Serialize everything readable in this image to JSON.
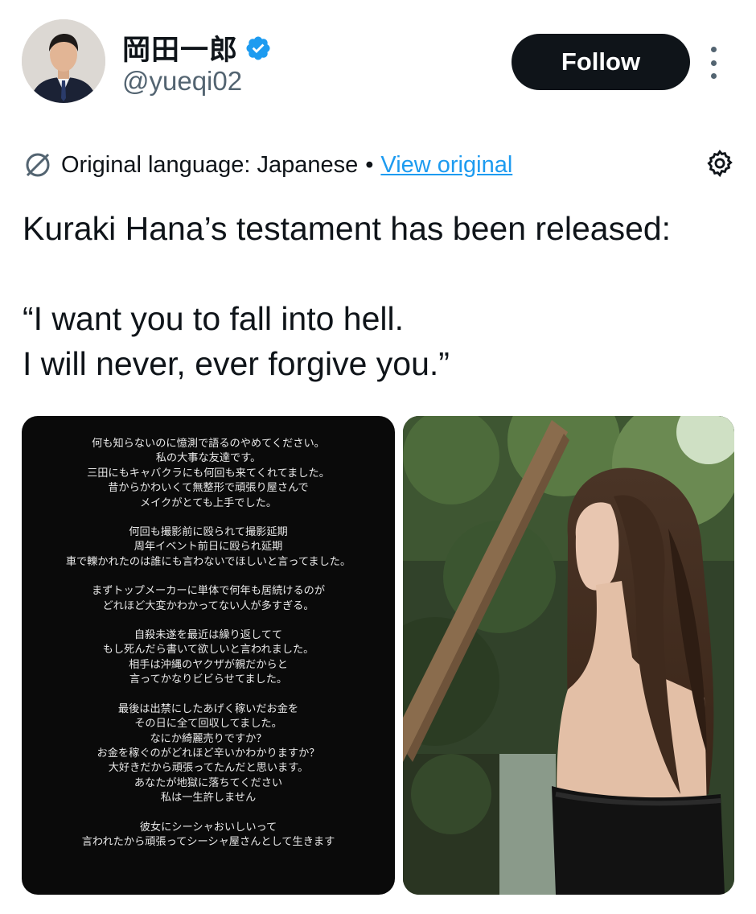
{
  "header": {
    "display_name": "岡田一郎",
    "handle": "@yueqi02",
    "follow_label": "Follow",
    "verified": true
  },
  "translation": {
    "original_language": "Original language: Japanese",
    "separator": "•",
    "view_original": "View original"
  },
  "tweet": {
    "text": "Kuraki Hana’s testament has been released:\n\n“I want you to fall into hell.\nI will never, ever forgive you.”"
  },
  "media": {
    "left_image_paragraphs": [
      [
        "何も知らないのに憶測で語るのやめてください。",
        "私の大事な友達です。",
        "三田にもキャバクラにも何回も来てくれてました。",
        "昔からかわいくて無整形で頑張り屋さんで",
        "メイクがとても上手でした。"
      ],
      [
        "何回も撮影前に殴られて撮影延期",
        "周年イベント前日に殴られ延期",
        "車で轢かれたのは誰にも言わないでほしいと言ってました。"
      ],
      [
        "まずトップメーカーに単体で何年も居続けるのが",
        "どれほど大変かわかってない人が多すぎる。"
      ],
      [
        "自殺未遂を最近は繰り返してて",
        "もし死んだら書いて欲しいと言われました。",
        "相手は沖縄のヤクザが親だからと",
        "言ってかなりビビらせてました。"
      ],
      [
        "最後は出禁にしたあげく稼いだお金を",
        "その日に全て回収してました。",
        "なにか綺麗売りですか？",
        "お金を稼ぐのがどれほど辛いかわかりますか？",
        "大好きだから頑張ってたんだと思います。",
        "あなたが地獄に落ちてください",
        "私は一生許しません"
      ],
      [
        "彼女にシーシャおいしいって",
        "言われたから頑張ってシーシャ屋さんとして生きます"
      ]
    ]
  },
  "colors": {
    "accent_link": "#1d9bf0",
    "follow_bg": "#0f1419",
    "secondary_text": "#536471"
  },
  "icons": {
    "verified": "verified-badge-icon",
    "translate": "translate-icon",
    "settings": "gear-icon",
    "more": "more-vertical-icon"
  }
}
